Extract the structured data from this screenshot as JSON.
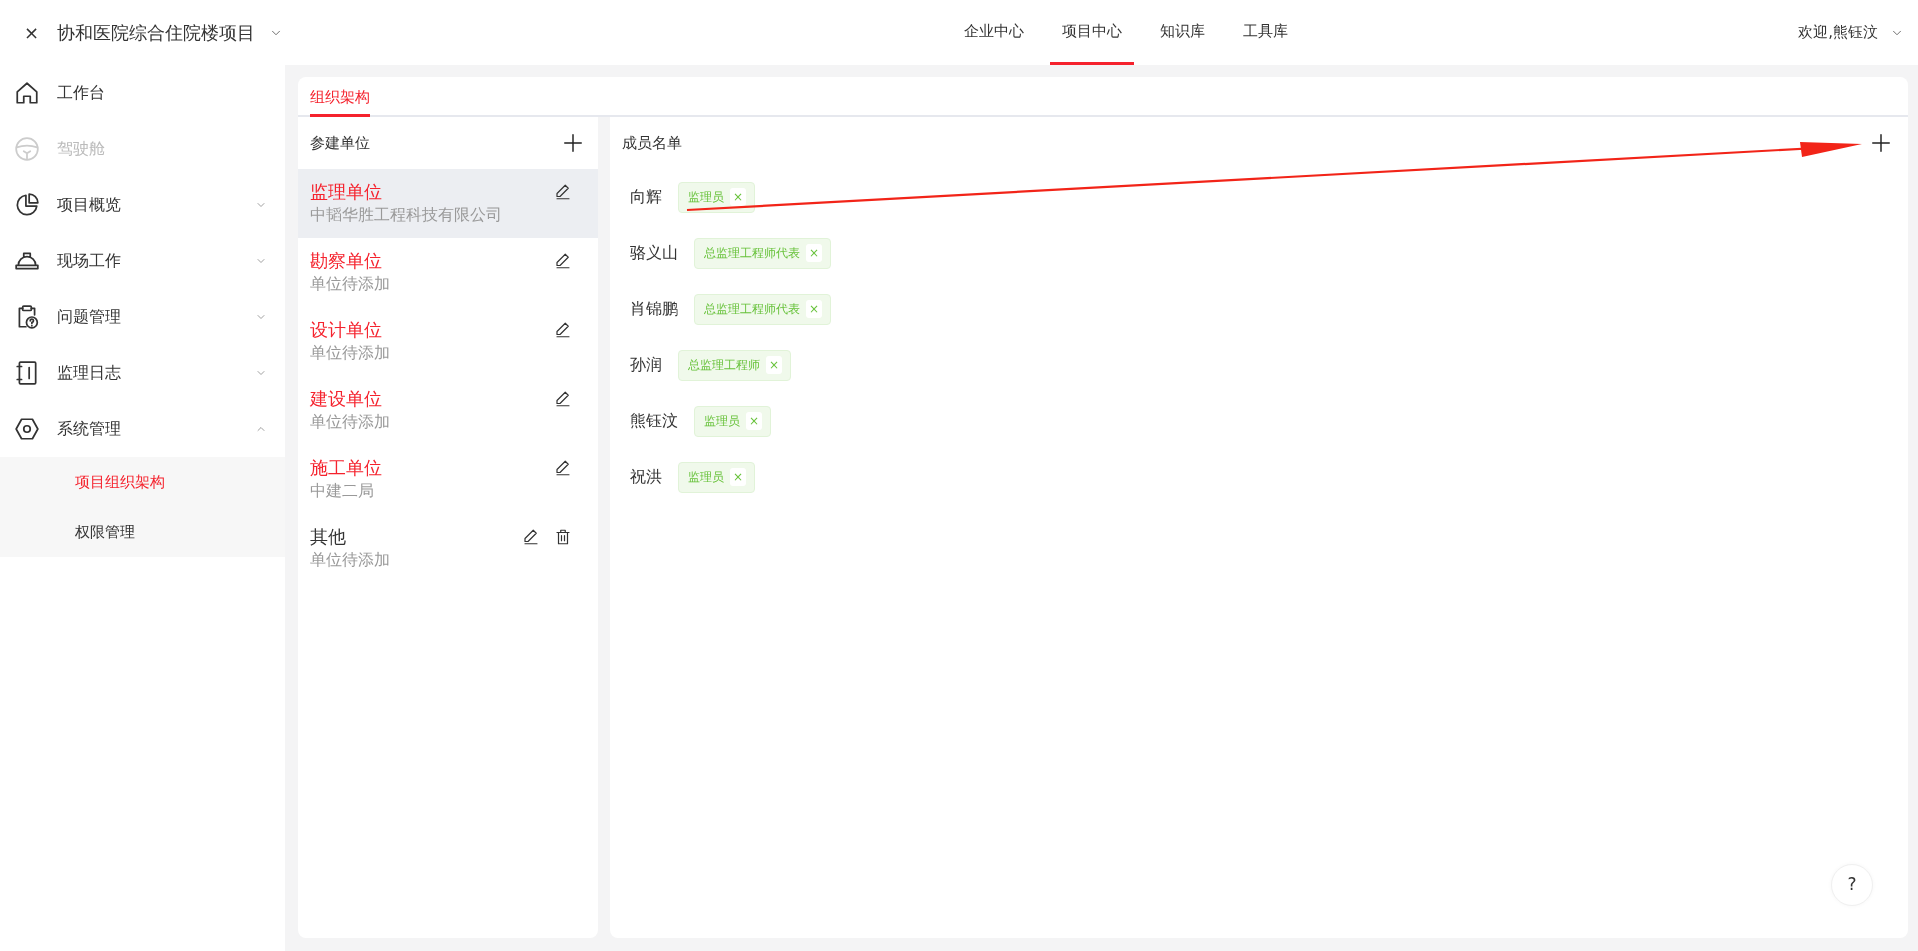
{
  "header": {
    "close": "×",
    "project_title": "协和医院综合住院楼项目",
    "nav": [
      {
        "label": "企业中心",
        "selected": false
      },
      {
        "label": "项目中心",
        "selected": true
      },
      {
        "label": "知识库",
        "selected": false
      },
      {
        "label": "工具库",
        "selected": false
      }
    ],
    "user": "欢迎,熊钰汶"
  },
  "sidebar": {
    "items": [
      {
        "label": "工作台",
        "disabled": false,
        "expandable": false
      },
      {
        "label": "驾驶舱",
        "disabled": true,
        "expandable": false
      },
      {
        "label": "项目概览",
        "disabled": false,
        "expandable": true,
        "expanded": false
      },
      {
        "label": "现场工作",
        "disabled": false,
        "expandable": true,
        "expanded": false
      },
      {
        "label": "问题管理",
        "disabled": false,
        "expandable": true,
        "expanded": false
      },
      {
        "label": "监理日志",
        "disabled": false,
        "expandable": true,
        "expanded": false
      },
      {
        "label": "系统管理",
        "disabled": false,
        "expandable": true,
        "expanded": true,
        "children": [
          {
            "label": "项目组织架构",
            "selected": true
          },
          {
            "label": "权限管理",
            "selected": false
          }
        ]
      }
    ]
  },
  "tabs": [
    {
      "label": "组织架构",
      "selected": true
    }
  ],
  "units": {
    "title": "参建单位",
    "items": [
      {
        "kind": "preset",
        "name": "监理单位",
        "subtitle": "中韬华胜工程科技有限公司",
        "selected": true
      },
      {
        "kind": "preset",
        "name": "勘察单位",
        "subtitle": "单位待添加",
        "selected": false
      },
      {
        "kind": "preset",
        "name": "设计单位",
        "subtitle": "单位待添加",
        "selected": false
      },
      {
        "kind": "preset",
        "name": "建设单位",
        "subtitle": "单位待添加",
        "selected": false
      },
      {
        "kind": "preset",
        "name": "施工单位",
        "subtitle": "中建二局",
        "selected": false
      },
      {
        "kind": "custom",
        "name": "其他",
        "subtitle": "单位待添加",
        "selected": false
      }
    ]
  },
  "members": {
    "title": "成员名单",
    "items": [
      {
        "name": "向辉",
        "role": "监理员",
        "remove": "×"
      },
      {
        "name": "骆义山",
        "role": "总监理工程师代表",
        "remove": "×"
      },
      {
        "name": "肖锦鹏",
        "role": "总监理工程师代表",
        "remove": "×"
      },
      {
        "name": "孙润",
        "role": "总监理工程师",
        "remove": "×"
      },
      {
        "name": "熊钰汶",
        "role": "监理员",
        "remove": "×"
      },
      {
        "name": "祝洪",
        "role": "监理员",
        "remove": "×"
      }
    ]
  },
  "help": "?",
  "annotations": [
    {
      "kind": "arrow"
    }
  ]
}
